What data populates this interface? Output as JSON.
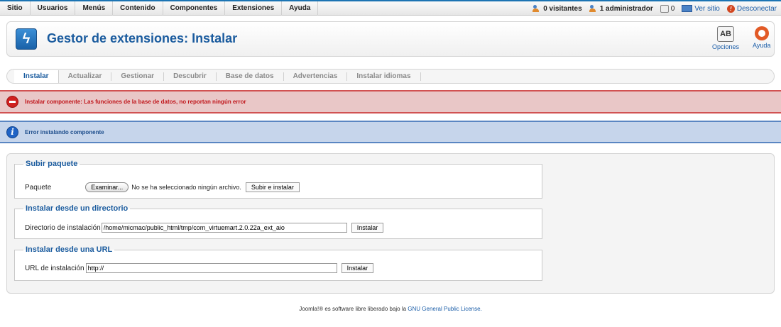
{
  "topmenu": {
    "items": [
      "Sitio",
      "Usuarios",
      "Menús",
      "Contenido",
      "Componentes",
      "Extensiones",
      "Ayuda"
    ],
    "visitors": "0 visitantes",
    "admins": "1 administrador",
    "messages": "0",
    "view_site": "Ver sitio",
    "logout": "Desconectar"
  },
  "header": {
    "title": "Gestor de extensiones: Instalar",
    "options": "Opciones",
    "help": "Ayuda"
  },
  "submenu": [
    "Instalar",
    "Actualizar",
    "Gestionar",
    "Descubrir",
    "Base de datos",
    "Advertencias",
    "Instalar idiomas"
  ],
  "messages": {
    "error": "Instalar componente: Las funciones de la base de datos, no reportan ningún error",
    "info": "Error instalando componente"
  },
  "upload": {
    "legend": "Subir paquete",
    "label": "Paquete",
    "browse": "Examinar...",
    "no_file": "No se ha seleccionado ningún archivo.",
    "submit": "Subir e instalar"
  },
  "directory": {
    "legend": "Instalar desde un directorio",
    "label": "Directorio de instalación",
    "value": "/home/micmac/public_html/tmp/com_virtuemart.2.0.22a_ext_aio",
    "submit": "Instalar"
  },
  "url": {
    "legend": "Instalar desde una URL",
    "label": "URL de instalación",
    "value": "http://",
    "submit": "Instalar"
  },
  "footer": {
    "prefix": "Joomla!® es software libre liberado bajo la ",
    "link": "GNU General Public License."
  },
  "colors": {
    "accent": "#1a5b9e",
    "error": "#c0161b",
    "info": "#1e4e8c"
  }
}
